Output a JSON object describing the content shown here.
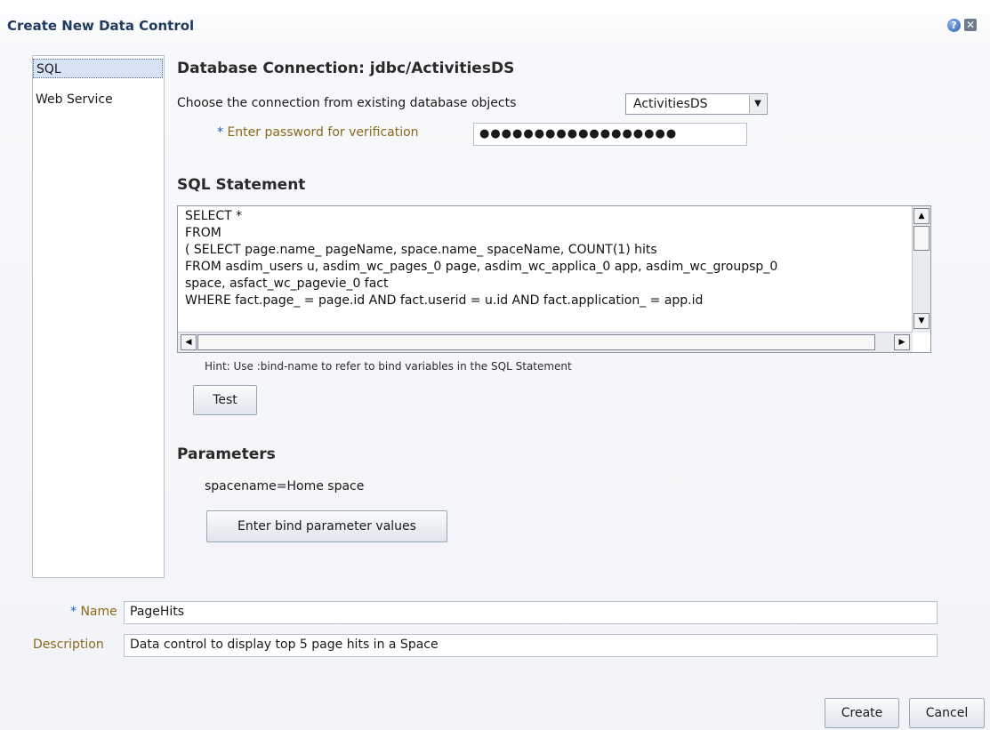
{
  "dialog": {
    "title": "Create New Data Control",
    "help_icon_glyph": "?",
    "close_icon_glyph": "✕"
  },
  "nav": {
    "items": [
      {
        "label": "SQL",
        "selected": true
      },
      {
        "label": "Web Service",
        "selected": false
      }
    ]
  },
  "connection": {
    "heading": "Database Connection: jdbc/ActivitiesDS",
    "choose_label": "Choose the connection from existing database objects",
    "selected": "ActivitiesDS",
    "password_label": "Enter password for verification",
    "password_mask": "●●●●●●●●●●●●●●●●●●"
  },
  "sql": {
    "heading": "SQL Statement",
    "lines": [
      "SELECT *",
      "FROM",
      "( SELECT page.name_ pageName, space.name_ spaceName, COUNT(1) hits",
      "FROM asdim_users u, asdim_wc_pages_0 page, asdim_wc_applica_0 app, asdim_wc_groupsp_0",
      "space, asfact_wc_pagevie_0 fact",
      "WHERE fact.page_        = page.id AND fact.userid = u.id AND fact.application_ = app.id"
    ],
    "hint": "Hint: Use :bind-name to refer to bind variables in the SQL Statement",
    "test_button": "Test"
  },
  "parameters": {
    "heading": "Parameters",
    "value": "spacename=Home space",
    "enter_button": "Enter bind parameter values"
  },
  "form": {
    "name_label": "Name",
    "name_value": "PageHits",
    "description_label": "Description",
    "description_value": "Data control to display top 5 page hits in a Space",
    "required_star": "*"
  },
  "footer": {
    "create_button": "Create",
    "cancel_button": "Cancel"
  }
}
